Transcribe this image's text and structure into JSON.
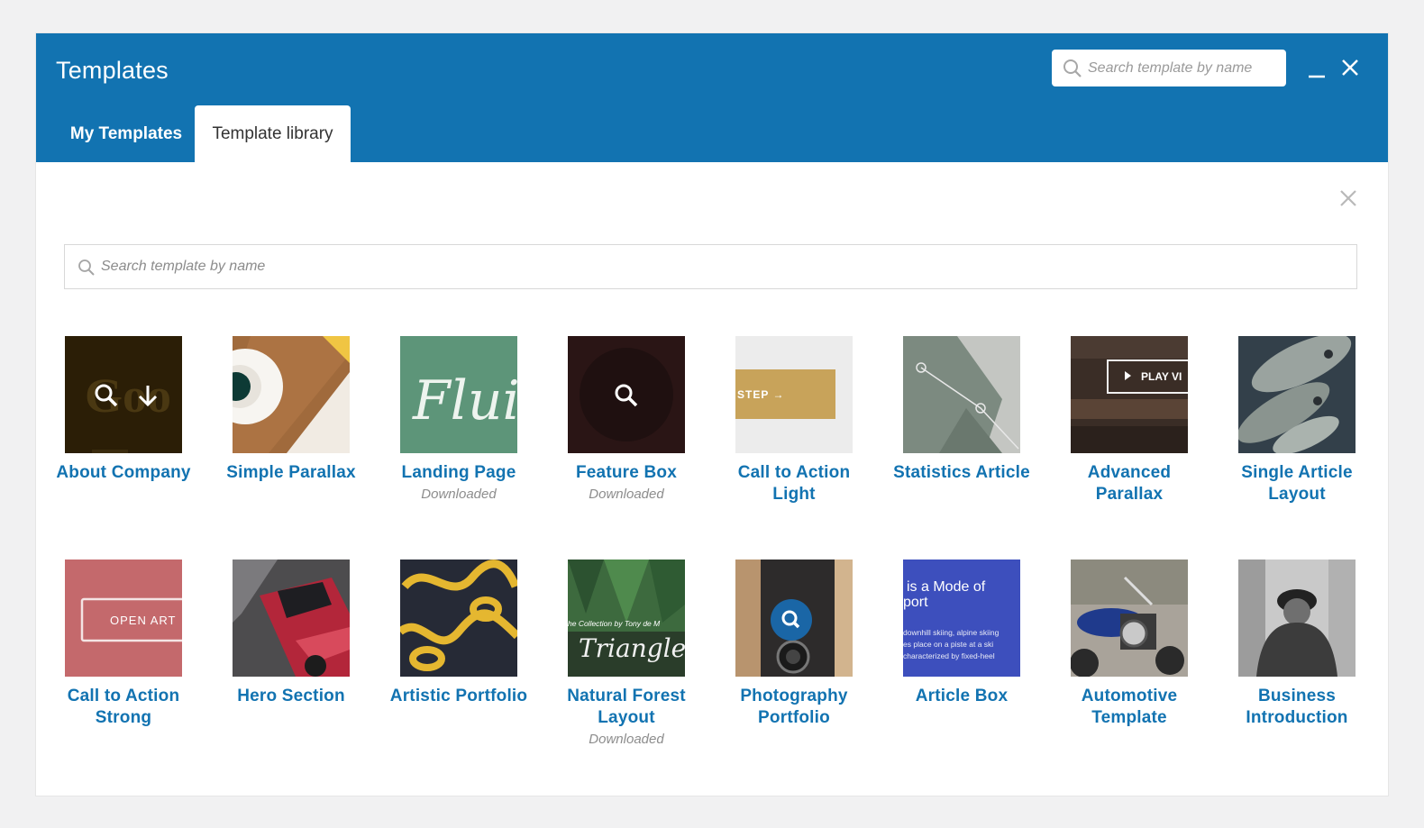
{
  "modal": {
    "title": "Templates",
    "search_placeholder": "Search template by name",
    "tabs": [
      {
        "label": "My Templates",
        "active": false
      },
      {
        "label": "Template library",
        "active": true
      }
    ],
    "colors": {
      "header": "#1273b1",
      "link": "#1273b1",
      "muted": "#8d8d8d"
    }
  },
  "library": {
    "search_placeholder": "Search template by name",
    "templates": [
      {
        "name": "About Company",
        "status": "",
        "thumb_text": "Goo"
      },
      {
        "name": "Simple Parallax",
        "status": ""
      },
      {
        "name": "Landing Page",
        "status": "Downloaded",
        "thumb_text": "Fluid"
      },
      {
        "name": "Feature Box",
        "status": "Downloaded"
      },
      {
        "name": "Call to Action Light",
        "status": "",
        "thumb_text": "STEP →"
      },
      {
        "name": "Statistics Article",
        "status": ""
      },
      {
        "name": "Advanced Parallax",
        "status": "",
        "thumb_text": "PLAY VI"
      },
      {
        "name": "Single Article Layout",
        "status": ""
      },
      {
        "name": "Call to Action Strong",
        "status": "",
        "thumb_text": "OPEN ART"
      },
      {
        "name": "Hero Section",
        "status": ""
      },
      {
        "name": "Artistic Portfolio",
        "status": ""
      },
      {
        "name": "Natural Forest Layout",
        "status": "Downloaded",
        "thumb_text": "he Collection by Tony de M",
        "thumb_text_2": "Triangle e"
      },
      {
        "name": "Photography Portfolio",
        "status": ""
      },
      {
        "name": "Article Box",
        "status": "",
        "thumb_text": "is a Mode of",
        "thumb_text_2": "port",
        "thumb_text_3": "downhill skiing, alpine skiing",
        "thumb_text_4": "es place on a piste at a ski",
        "thumb_text_5": "characterized by fixed-heel"
      },
      {
        "name": "Automotive Template",
        "status": ""
      },
      {
        "name": "Business Introduction",
        "status": ""
      }
    ]
  }
}
